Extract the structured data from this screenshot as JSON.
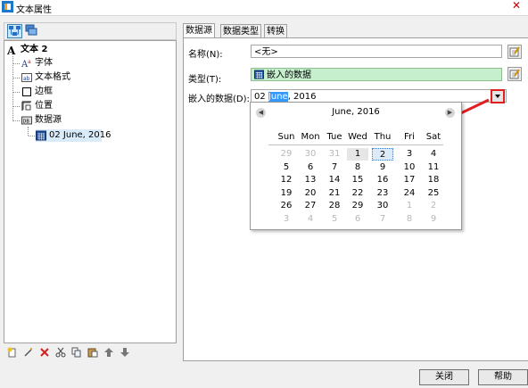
{
  "window": {
    "title": "文本属性",
    "close_glyph": "✕"
  },
  "tree": {
    "root_label": "文本 2",
    "items": [
      {
        "label": "字体",
        "icon": "font-icon"
      },
      {
        "label": "文本格式",
        "icon": "text-format-icon"
      },
      {
        "label": "边框",
        "icon": "border-icon"
      },
      {
        "label": "位置",
        "icon": "position-icon"
      },
      {
        "label": "数据源",
        "icon": "datasource-icon"
      }
    ],
    "child_label": "02 June, 2016"
  },
  "tabs": [
    {
      "label": "数据源",
      "active": true
    },
    {
      "label": "数据类型",
      "active": false
    },
    {
      "label": "转换",
      "active": false
    }
  ],
  "form": {
    "name_label": "名称(N):",
    "name_value": "<无>",
    "type_label": "类型(T):",
    "type_value": "嵌入的数据",
    "embedded_label": "嵌入的数据(D):",
    "embedded_day": "02 ",
    "embedded_month": "June",
    "embedded_year": ", 2016"
  },
  "calendar": {
    "month_title": "June, 2016",
    "prev_glyph": "◀",
    "next_glyph": "▶",
    "weekdays": [
      "Sun",
      "Mon",
      "Tue",
      "Wed",
      "Thu",
      "Fri",
      "Sat"
    ],
    "weeks": [
      [
        "29",
        "30",
        "31",
        "1",
        "2",
        "3",
        "4"
      ],
      [
        "5",
        "6",
        "7",
        "8",
        "9",
        "10",
        "11"
      ],
      [
        "12",
        "13",
        "14",
        "15",
        "16",
        "17",
        "18"
      ],
      [
        "19",
        "20",
        "21",
        "22",
        "23",
        "24",
        "25"
      ],
      [
        "26",
        "27",
        "28",
        "29",
        "30",
        "1",
        "2"
      ],
      [
        "3",
        "4",
        "5",
        "6",
        "7",
        "8",
        "9"
      ]
    ],
    "selected_day": "2",
    "today_day": "1"
  },
  "buttons": {
    "close": "关闭",
    "help": "帮助"
  },
  "colors": {
    "accent_red": "#e02020",
    "green_field": "#c6efce",
    "selection": "#d9ebf9"
  }
}
